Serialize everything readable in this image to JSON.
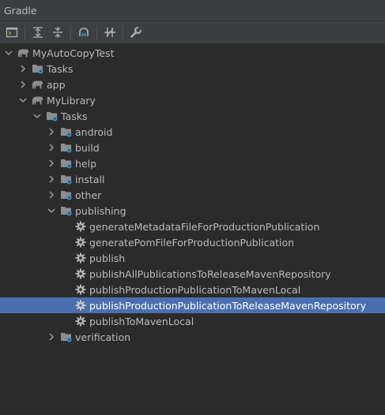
{
  "panel": {
    "title": "Gradle"
  },
  "toolbar": {
    "buttons": [
      {
        "name": "execute-task-button",
        "icon": "terminal-icon"
      },
      {
        "name": "expand-all-button",
        "icon": "expand-all-icon"
      },
      {
        "name": "collapse-all-button",
        "icon": "collapse-all-icon"
      },
      {
        "name": "link-project-button",
        "icon": "elephant-link-icon"
      },
      {
        "name": "toggle-offline-button",
        "icon": "offline-icon"
      },
      {
        "name": "settings-button",
        "icon": "wrench-icon"
      }
    ]
  },
  "tree": {
    "root": {
      "label": "MyAutoCopyTest",
      "expanded": true
    },
    "root_tasks": {
      "label": "Tasks",
      "expanded": false
    },
    "app": {
      "label": "app",
      "expanded": false
    },
    "mylibrary": {
      "label": "MyLibrary",
      "expanded": true
    },
    "mylibrary_tasks": {
      "label": "Tasks",
      "expanded": true
    },
    "groups": {
      "android": "android",
      "build": "build",
      "help": "help",
      "install": "install",
      "other": "other",
      "publishing": "publishing",
      "verification": "verification"
    },
    "publishing_tasks": [
      "generateMetadataFileForProductionPublication",
      "generatePomFileForProductionPublication",
      "publish",
      "publishAllPublicationsToReleaseMavenRepository",
      "publishProductionPublicationToMavenLocal",
      "publishProductionPublicationToReleaseMavenRepository",
      "publishToMavenLocal"
    ],
    "selected_task": "publishProductionPublicationToReleaseMavenRepository"
  },
  "colors": {
    "background": "#2b2b2b",
    "toolbar": "#3c3f41",
    "selection": "#4b6eaf",
    "text": "#bbbbbb",
    "gear": "#afb1b3",
    "folder": "#8c8e90",
    "gradle_badge": "#3592c4"
  }
}
